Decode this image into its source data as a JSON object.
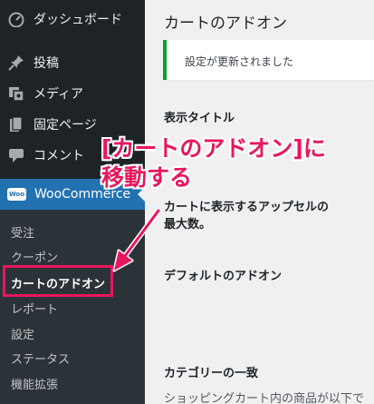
{
  "sidebar": {
    "dashboard": "ダッシュボード",
    "posts": "投稿",
    "media": "メディア",
    "pages": "固定ページ",
    "comments": "コメント",
    "woocommerce": {
      "badge": "Woo",
      "label": "WooCommerce"
    },
    "submenu": {
      "orders": "受注",
      "coupons": "クーポン",
      "cart_addons": "カートのアドオン",
      "reports": "レポート",
      "settings": "設定",
      "status": "ステータス",
      "extensions": "機能拡張"
    }
  },
  "main": {
    "page_title": "カートのアドオン",
    "notice": "設定が更新されました",
    "fields": {
      "display_title": "表示タイトル",
      "max_upsells_line1": "カートに表示するアップセルの",
      "max_upsells_line2": "最大数。",
      "default_addons": "デフォルトのアドオン",
      "category_match": "カテゴリーの一致",
      "truncated_description": "ショッピングカート内の商品が以下で"
    }
  },
  "annotation": {
    "line1": "[カートのアドオン]に",
    "line2": "移動する",
    "color": "#e8175d"
  },
  "colors": {
    "sidebar_bg": "#1d2327",
    "submenu_bg": "#2c3338",
    "active_bg": "#2271b1",
    "notice_border": "#00a32a",
    "highlight": "#e8175d"
  }
}
